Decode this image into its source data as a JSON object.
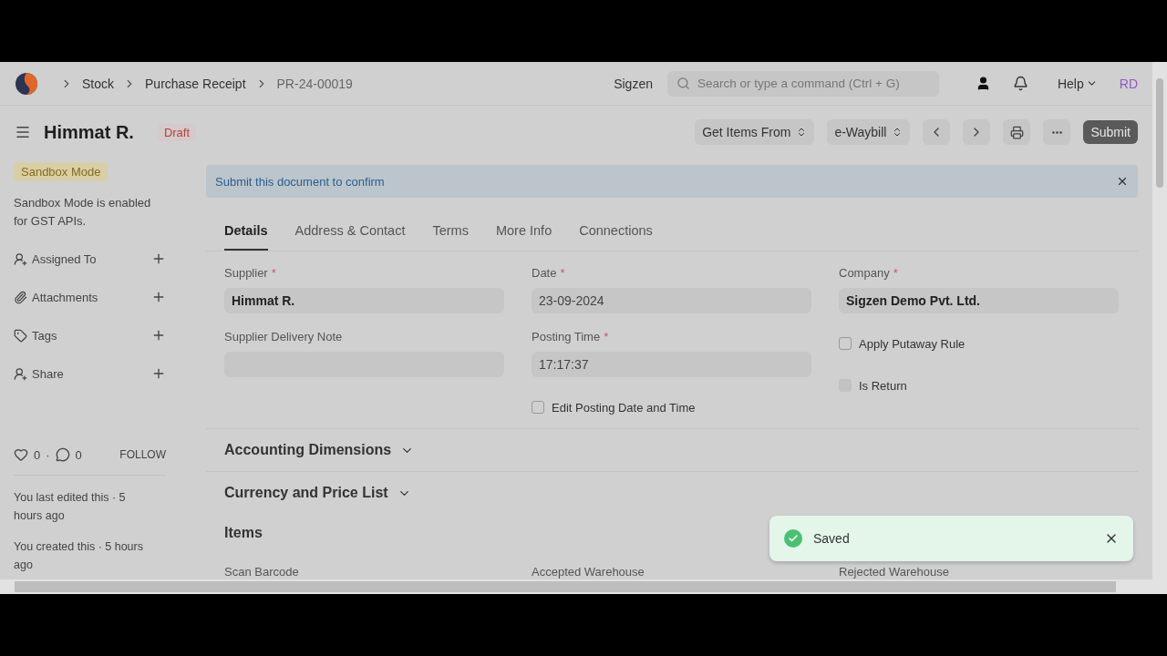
{
  "navbar": {
    "breadcrumbs": [
      "Stock",
      "Purchase Receipt",
      "PR-24-00019"
    ],
    "company": "Sigzen",
    "search": {
      "placeholder": "Search or type a command (Ctrl + G)"
    },
    "help": "Help",
    "avatar": "RD"
  },
  "header": {
    "title": "Himmat R.",
    "status": "Draft",
    "actions": [
      {
        "kind": "select",
        "label": "Get Items From"
      },
      {
        "kind": "select",
        "label": "e-Waybill"
      },
      {
        "kind": "prev"
      },
      {
        "kind": "next"
      },
      {
        "kind": "print"
      },
      {
        "kind": "more"
      },
      {
        "kind": "primary",
        "label": "Submit"
      }
    ]
  },
  "sidebar": {
    "badge": "Sandbox Mode",
    "note": "Sandbox Mode is enabled for GST APIs.",
    "items": [
      {
        "kind": "user",
        "label": "Assigned To"
      },
      {
        "kind": "clip",
        "label": "Attachments"
      },
      {
        "kind": "tag",
        "label": "Tags"
      },
      {
        "kind": "user",
        "label": "Share"
      }
    ],
    "likes": "0",
    "separator": "·",
    "comments": "0",
    "follow": "FOLLOW",
    "activity": [
      "You last edited this · 5 hours ago",
      "You created this · 5 hours ago"
    ]
  },
  "alert": {
    "text": "Submit this document to confirm"
  },
  "tabs": [
    {
      "label": "Details",
      "selected": true
    },
    {
      "label": "Address & Contact",
      "selected": false
    },
    {
      "label": "Terms",
      "selected": false
    },
    {
      "label": "More Info",
      "selected": false
    },
    {
      "label": "Connections",
      "selected": false
    }
  ],
  "columns": [
    [
      {
        "kind": "input",
        "label": "Supplier",
        "required_mark": "*",
        "value": "Himmat R.",
        "bold": true
      },
      {
        "kind": "input",
        "label": "Supplier Delivery Note"
      }
    ],
    [
      {
        "kind": "input",
        "label": "Date",
        "required_mark": "*",
        "value": "23-09-2024",
        "bold": false
      },
      {
        "kind": "input",
        "label": "Posting Time",
        "required_mark": "*",
        "value": "17:17:37",
        "bold": false
      },
      {
        "kind": "check",
        "label": "Edit Posting Date and Time",
        "checked": false,
        "disabled": false
      }
    ],
    [
      {
        "kind": "input",
        "label": "Company",
        "required_mark": "*",
        "value": "Sigzen Demo Pvt. Ltd.",
        "bold": true
      },
      {
        "kind": "check",
        "label": "Apply Putaway Rule",
        "checked": false,
        "disabled": false
      },
      {
        "kind": "check",
        "label": "Is Return",
        "checked": false,
        "disabled": true
      }
    ]
  ],
  "sections": [
    {
      "title": "Accounting Dimensions",
      "expanded": false
    },
    {
      "title": "Currency and Price List",
      "expanded": false
    }
  ],
  "items": {
    "title": "Items",
    "labels": [
      "Scan Barcode",
      "Accepted Warehouse",
      "Rejected Warehouse"
    ]
  },
  "toast": {
    "text": "Saved"
  }
}
